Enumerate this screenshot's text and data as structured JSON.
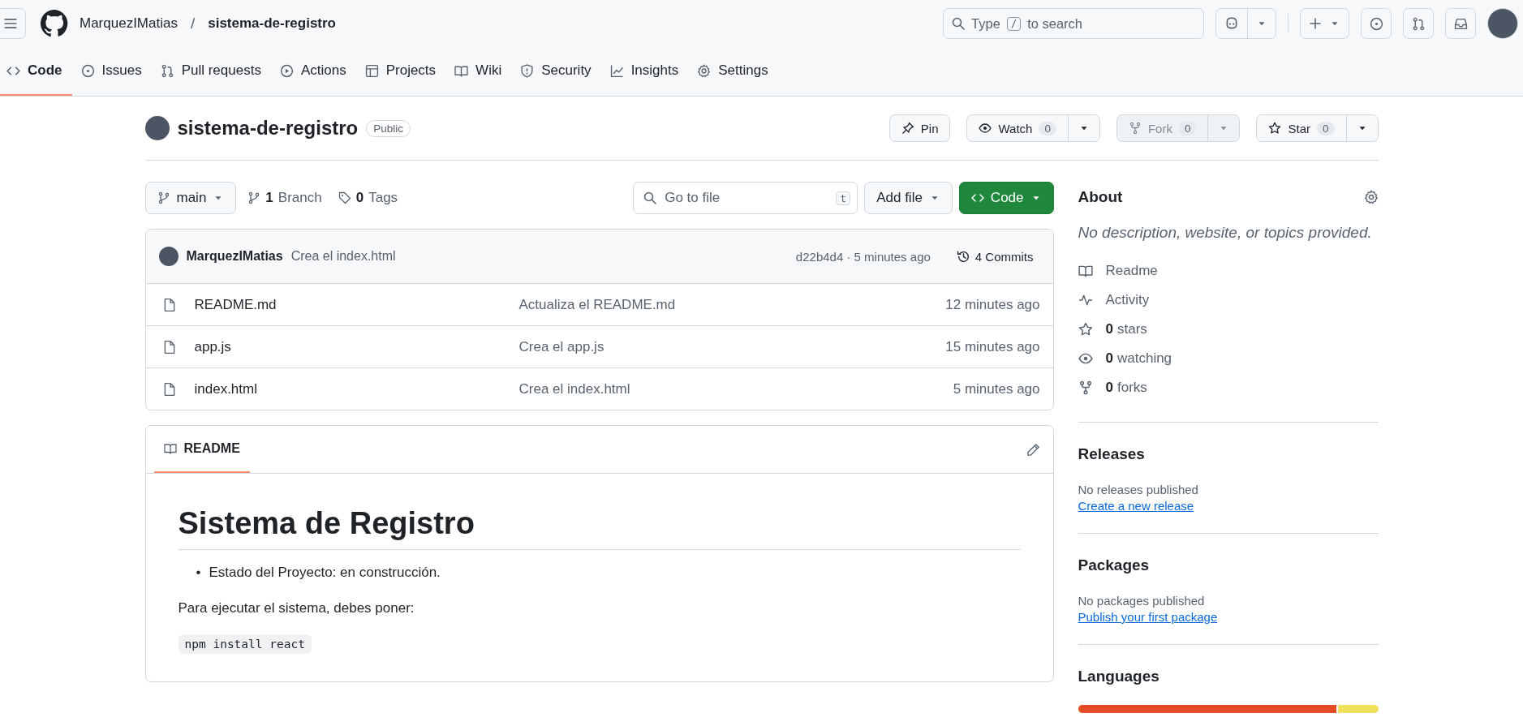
{
  "header": {
    "owner": "MarquezIMatias",
    "separator": "/",
    "repo": "sistema-de-registro",
    "search": {
      "before": "Type",
      "key": "/",
      "after": "to search"
    }
  },
  "nav_tabs": [
    {
      "kind": "code",
      "label": "Code",
      "selected": true
    },
    {
      "kind": "issues",
      "label": "Issues",
      "selected": false
    },
    {
      "kind": "pulls",
      "label": "Pull requests",
      "selected": false
    },
    {
      "kind": "actions",
      "label": "Actions",
      "selected": false
    },
    {
      "kind": "projects",
      "label": "Projects",
      "selected": false
    },
    {
      "kind": "wiki",
      "label": "Wiki",
      "selected": false
    },
    {
      "kind": "security",
      "label": "Security",
      "selected": false
    },
    {
      "kind": "insights",
      "label": "Insights",
      "selected": false
    },
    {
      "kind": "settings",
      "label": "Settings",
      "selected": false
    }
  ],
  "repo_header": {
    "title": "sistema-de-registro",
    "visibility": "Public",
    "actions": [
      {
        "kind": "pin",
        "label": "Pin",
        "disabled": false
      },
      {
        "kind": "watch",
        "label": "Watch",
        "count": "0",
        "disabled": false
      },
      {
        "kind": "fork",
        "label": "Fork",
        "count": "0",
        "disabled": true
      },
      {
        "kind": "star",
        "label": "Star",
        "count": "0",
        "disabled": false
      }
    ]
  },
  "toolbar": {
    "branch": "main",
    "branch_count": "1",
    "branch_label": "Branch",
    "tag_count": "0",
    "tag_label": "Tags",
    "go_to_file": {
      "placeholder": "Go to file",
      "key": "t"
    },
    "add_file": "Add file",
    "code": "Code"
  },
  "latest_commit": {
    "author": "MarquezIMatias",
    "message": "Crea el index.html",
    "hash_time": "d22b4d4 · 5 minutes ago",
    "commits": "4 Commits"
  },
  "files": [
    {
      "name": "README.md",
      "message": "Actualiza el README.md",
      "time": "12 minutes ago"
    },
    {
      "name": "app.js",
      "message": "Crea el app.js",
      "time": "15 minutes ago"
    },
    {
      "name": "index.html",
      "message": "Crea el index.html",
      "time": "5 minutes ago"
    }
  ],
  "readme": {
    "tab": "README",
    "heading": "Sistema de Registro",
    "bullets": [
      {
        "marker": "•",
        "text": "Estado del Proyecto: en construcción."
      }
    ],
    "paragraph": "Para ejecutar el sistema, debes poner:",
    "code": "npm install react"
  },
  "sidebar": {
    "about": {
      "title": "About",
      "description": "No description, website, or topics provided.",
      "links": [
        {
          "kind": "readme",
          "label": "Readme"
        },
        {
          "kind": "activity",
          "label": "Activity"
        },
        {
          "kind": "stars",
          "count": "0",
          "label": "stars"
        },
        {
          "kind": "watching",
          "count": "0",
          "label": "watching"
        },
        {
          "kind": "forks",
          "count": "0",
          "label": "forks"
        }
      ]
    },
    "releases": {
      "title": "Releases",
      "text": "No releases published",
      "link": "Create a new release"
    },
    "packages": {
      "title": "Packages",
      "text": "No packages published",
      "link": "Publish your first package"
    },
    "languages": {
      "title": "Languages",
      "items": [
        {
          "color": "#e34c26",
          "level": 0.862
        },
        {
          "color": "#f1e05a"
        }
      ]
    }
  }
}
